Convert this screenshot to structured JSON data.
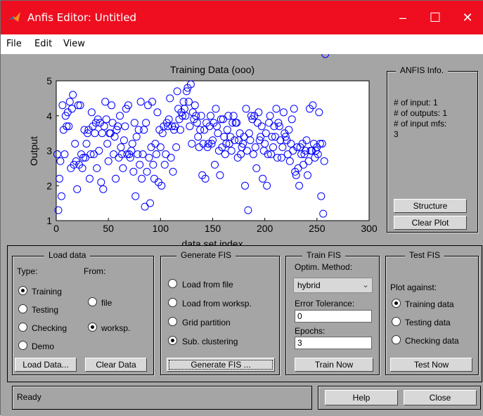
{
  "window": {
    "title": "Anfis Editor: Untitled"
  },
  "menu": [
    "File",
    "Edit",
    "View"
  ],
  "plot": {
    "title": "Training Data (ooo)",
    "xlabel": "data set index",
    "ylabel": "Output",
    "xticks": [
      "0",
      "50",
      "100",
      "150",
      "200",
      "250",
      "300"
    ],
    "yticks": [
      "1",
      "2",
      "3",
      "4",
      "5"
    ]
  },
  "chart_data": {
    "type": "scatter",
    "title": "Training Data (ooo)",
    "xlabel": "data set index",
    "ylabel": "Output",
    "xlim": [
      0,
      300
    ],
    "ylim": [
      1,
      5
    ],
    "marker": "circle",
    "color": "#0000ff",
    "x": [
      1,
      2,
      3,
      4,
      5,
      6,
      7,
      8,
      9,
      10,
      11,
      12,
      13,
      14,
      15,
      16,
      17,
      18,
      19,
      20,
      21,
      22,
      23,
      24,
      25,
      26,
      27,
      28,
      29,
      30,
      31,
      32,
      33,
      34,
      35,
      36,
      37,
      38,
      39,
      40,
      41,
      42,
      43,
      44,
      45,
      46,
      47,
      48,
      49,
      50,
      51,
      52,
      53,
      54,
      55,
      56,
      57,
      58,
      59,
      60,
      61,
      62,
      63,
      64,
      65,
      66,
      67,
      68,
      69,
      70,
      71,
      72,
      73,
      74,
      75,
      76,
      77,
      78,
      79,
      80,
      81,
      82,
      83,
      84,
      85,
      86,
      87,
      88,
      89,
      90,
      91,
      92,
      93,
      94,
      95,
      96,
      97,
      98,
      99,
      100,
      101,
      102,
      103,
      104,
      105,
      106,
      107,
      108,
      109,
      110,
      111,
      112,
      113,
      114,
      115,
      116,
      117,
      118,
      119,
      120,
      121,
      122,
      123,
      124,
      125,
      126,
      127,
      128,
      129,
      130,
      131,
      132,
      133,
      134,
      135,
      136,
      137,
      138,
      139,
      140,
      141,
      142,
      143,
      144,
      145,
      146,
      147,
      148,
      149,
      150,
      151,
      152,
      153,
      154,
      155,
      156,
      157,
      158,
      159,
      160,
      161,
      162,
      163,
      164,
      165,
      166,
      167,
      168,
      169,
      170,
      171,
      172,
      173,
      174,
      175,
      176,
      177,
      178,
      179,
      180,
      181,
      182,
      183,
      184,
      185,
      186,
      187,
      188,
      189,
      190,
      191,
      192,
      193,
      194,
      195,
      196,
      197,
      198,
      199,
      200,
      201,
      202,
      203,
      204,
      205,
      206,
      207,
      208,
      209,
      210,
      211,
      212,
      213,
      214,
      215,
      216,
      217,
      218,
      219,
      220,
      221,
      222,
      223,
      224,
      225,
      226,
      227,
      228,
      229,
      230,
      231,
      232,
      233,
      234,
      235,
      236,
      237,
      238,
      239,
      240,
      241,
      242,
      243,
      244,
      245,
      246,
      247,
      248,
      249,
      250,
      251,
      252,
      253,
      254,
      255,
      256,
      257,
      258
    ],
    "y": [
      2.9,
      1.3,
      2.2,
      2.7,
      1.7,
      4.3,
      3.6,
      2.9,
      4.0,
      3.7,
      4.1,
      3.7,
      4.4,
      2.5,
      4.2,
      4.6,
      2.6,
      3.2,
      2.7,
      1.9,
      4.3,
      2.6,
      4.3,
      2.9,
      2.5,
      2.8,
      3.6,
      2.8,
      3.2,
      3.5,
      3.6,
      2.2,
      2.9,
      4.1,
      3.7,
      2.9,
      3.5,
      3.8,
      2.5,
      3.9,
      3.0,
      3.8,
      2.1,
      3.5,
      1.9,
      3.7,
      4.4,
      3.9,
      3.2,
      2.7,
      3.5,
      3.5,
      4.3,
      3.8,
      2.9,
      3.4,
      2.2,
      3.6,
      3.7,
      2.8,
      4.0,
      3.1,
      2.9,
      2.5,
      3.3,
      3.7,
      4.2,
      2.9,
      4.3,
      2.9,
      2.8,
      3.0,
      3.2,
      2.4,
      3.8,
      1.7,
      3.4,
      2.9,
      3.6,
      2.6,
      4.4,
      2.2,
      2.9,
      3.6,
      1.4,
      3.8,
      2.4,
      4.3,
      2.8,
      1.5,
      3.1,
      4.4,
      2.6,
      2.2,
      3.2,
      2.9,
      4.1,
      2.1,
      3.6,
      3.1,
      2.0,
      3.5,
      3.7,
      2.6,
      2.9,
      3.8,
      3.7,
      3.9,
      4.5,
      2.8,
      3.7,
      2.4,
      3.6,
      3.7,
      3.1,
      4.7,
      4.2,
      3.9,
      3.6,
      4.1,
      4.0,
      4.4,
      4.2,
      4.0,
      4.7,
      4.8,
      4.4,
      3.7,
      4.9,
      3.2,
      4.1,
      3.9,
      4.3,
      4.0,
      3.8,
      3.4,
      3.1,
      3.6,
      4.0,
      2.3,
      3.2,
      3.6,
      2.2,
      3.8,
      3.1,
      3.2,
      3.7,
      4.0,
      3.2,
      3.3,
      3.8,
      2.6,
      4.2,
      3.7,
      3.5,
      3.0,
      2.3,
      3.9,
      3.1,
      3.9,
      3.4,
      2.9,
      3.2,
      3.6,
      4.0,
      3.2,
      3.4,
      3.0,
      3.8,
      4.0,
      3.3,
      3.8,
      3.8,
      2.8,
      3.3,
      3.5,
      2.9,
      3.1,
      3.2,
      3.4,
      2.0,
      4.2,
      3.0,
      1.3,
      3.5,
      3.3,
      4.0,
      3.9,
      2.9,
      4.0,
      3.1,
      2.5,
      3.8,
      4.1,
      3.3,
      3.4,
      3.7,
      2.2,
      3.0,
      3.2,
      3.5,
      2.0,
      2.9,
      3.8,
      4.0,
      2.9,
      3.4,
      3.1,
      3.7,
      3.4,
      4.2,
      2.8,
      3.8,
      3.7,
      3.3,
      2.8,
      3.1,
      4.1,
      3.5,
      3.4,
      3.3,
      2.9,
      3.6,
      2.7,
      3.2,
      3.9,
      3.0,
      4.2,
      2.4,
      2.3,
      3.1,
      2.5,
      2.0,
      3.1,
      2.9,
      3.2,
      2.6,
      2.9,
      3.0,
      3.3,
      2.3,
      2.7,
      4.2,
      3.0,
      3.0,
      4.3,
      3.2,
      2.8,
      3.0,
      3.1,
      2.9,
      4.1,
      3.2,
      1.7,
      3.2,
      1.2,
      2.7
    ]
  },
  "info": {
    "title": "ANFIS Info.",
    "line1": "# of input: 1",
    "line2": "# of outputs: 1",
    "line3": "# of input mfs:",
    "line4": "3",
    "structure_label": "Structure",
    "clearplot_label": "Clear Plot"
  },
  "load": {
    "title": "Load data",
    "type_label": "Type:",
    "from_label": "From:",
    "types": [
      "Training",
      "Testing",
      "Checking",
      "Demo"
    ],
    "type_selected": 0,
    "from": [
      "file",
      "worksp."
    ],
    "from_selected": 1,
    "load_btn": "Load Data...",
    "clear_btn": "Clear Data"
  },
  "gen": {
    "title": "Generate FIS",
    "options": [
      "Load from file",
      "Load from worksp.",
      "Grid partition",
      "Sub. clustering"
    ],
    "selected": 3,
    "button": "Generate FIS ..."
  },
  "train": {
    "title": "Train FIS",
    "method_label": "Optim. Method:",
    "method_value": "hybrid",
    "tol_label": "Error Tolerance:",
    "tol_value": "0",
    "epochs_label": "Epochs:",
    "epochs_value": "3",
    "button": "Train Now"
  },
  "test": {
    "title": "Test FIS",
    "plot_label": "Plot against:",
    "options": [
      "Training data",
      "Testing data",
      "Checking data"
    ],
    "selected": 0,
    "button": "Test Now"
  },
  "status": {
    "text": "Ready"
  },
  "help_label": "Help",
  "close_label": "Close"
}
